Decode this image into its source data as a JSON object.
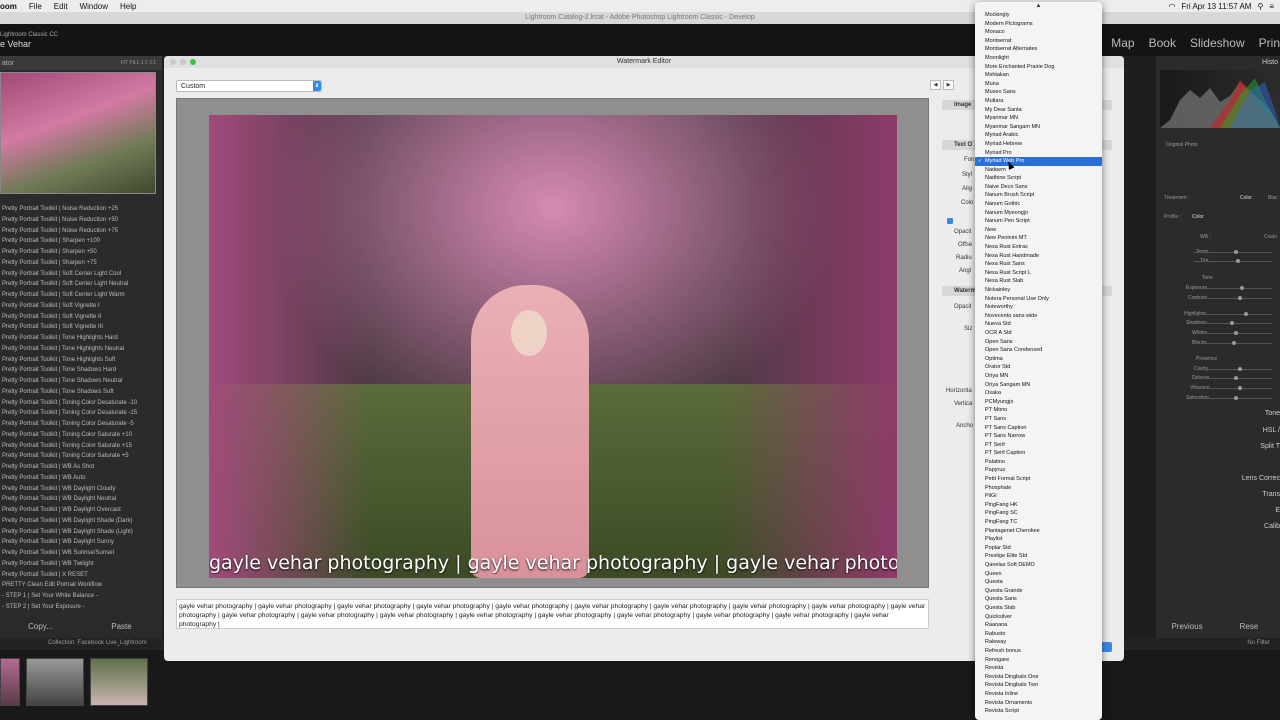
{
  "menubar": {
    "app": "oom",
    "items": [
      "File",
      "Edit",
      "Window",
      "Help"
    ],
    "clock": "Fri Apr 13  11:57 AM"
  },
  "lr_title": "Lightroom Catalog-2.lrcat - Adobe Photoshop Lightroom Classic - Develop",
  "lr_header": {
    "product": "Lightroom Classic CC",
    "user": "e Vehar",
    "modules": [
      "Map",
      "Book",
      "Slideshow",
      "Prin"
    ]
  },
  "left_panel": {
    "title": "ator",
    "zoom": [
      "FIT",
      "FILL",
      "1:1",
      "3:1"
    ],
    "presets": [
      "Pretty Portrait Toolkit | Noise Reduction +25",
      "Pretty Portrait Toolkit | Noise Reduction +50",
      "Pretty Portrait Toolkit | Noise Reduction +75",
      "Pretty Portrait Toolkit | Sharpen +100",
      "Pretty Portrait Toolkit | Sharpen +50",
      "Pretty Portrait Toolkit | Sharpen +75",
      "Pretty Portrait Toolkit | Soft Center Light Cool",
      "Pretty Portrait Toolkit | Soft Center Light Neutral",
      "Pretty Portrait Toolkit | Soft Center Light Warm",
      "Pretty Portrait Toolkit | Soft Vignette I",
      "Pretty Portrait Toolkit | Soft Vignette II",
      "Pretty Portrait Toolkit | Soft Vignette III",
      "Pretty Portrait Toolkit | Tone Highlights Hard",
      "Pretty Portrait Toolkit | Tone Highlights Neutral",
      "Pretty Portrait Toolkit | Tone Highlights Soft",
      "Pretty Portrait Toolkit | Tone Shadows Hard",
      "Pretty Portrait Toolkit | Tone Shadows Neutral",
      "Pretty Portrait Toolkit | Tone Shadows Soft",
      "Pretty Portrait Toolkit | Toning Color Desaturate -10",
      "Pretty Portrait Toolkit | Toning Color Desaturate -15",
      "Pretty Portrait Toolkit | Toning Color Desaturate -5",
      "Pretty Portrait Toolkit | Toning Color Saturate +10",
      "Pretty Portrait Toolkit | Toning Color Saturate +15",
      "Pretty Portrait Toolkit | Toning Color Saturate +5",
      "Pretty Portrait Toolkit | WB As Shot",
      "Pretty Portrait Toolkit | WB Auto",
      "Pretty Portrait Toolkit | WB Daylight Cloudy",
      "Pretty Portrait Toolkit | WB Daylight Neutral",
      "Pretty Portrait Toolkit | WB Daylight Overcast",
      "Pretty Portrait Toolkit | WB Daylight Shade (Dark)",
      "Pretty Portrait Toolkit | WB Daylight Shade (Light)",
      "Pretty Portrait Toolkit | WB Daylight Sunny",
      "Pretty Portrait Toolkit | WB Sunrise/Sunset",
      "Pretty Portrait Toolkit | WB Twilight",
      "Pretty Portrait Toolkit | X RESET",
      "PRETTY Clean Edit Portrait Workflow",
      "- STEP 1 | Set Your White Balance -",
      "- STEP 2 | Set Your Exposure -"
    ],
    "copy": "Copy...",
    "paste": "Paste"
  },
  "right_panel": {
    "histogram": "Histo",
    "original": "Original Photo",
    "treatment": "Treatment :",
    "color": "Color",
    "bw": "Blac",
    "profile": "Profile :",
    "profile_val": "Color",
    "wb": "WB :",
    "wb_val": "Custo",
    "temp": "Temp",
    "tint": "Tint",
    "tone": "Tone",
    "sliders": [
      "Exposure",
      "Contrast",
      "Highlights",
      "Shadows",
      "Whites",
      "Blacks"
    ],
    "presence": "Presence",
    "presence_sliders": [
      "Clarity",
      "Dehaze",
      "Vibrance",
      "Saturation"
    ],
    "sections": [
      "Tone",
      "HSL /",
      "Split T",
      "Lens Correc",
      "Trans",
      "E",
      "Calib"
    ],
    "previous": "Previous",
    "reset": "Rese"
  },
  "filmstrip": {
    "collection": "Collection: Facebook Live_Lightroom",
    "filter": "No Filter"
  },
  "dialog": {
    "title": "Watermark Editor",
    "preset": "Custom",
    "watermark_overlay": "gayle vehar photography | gayle vehar photography | gayle vehar photogra",
    "watermark_text": "gayle vehar photography | gayle vehar photography | gayle vehar photography | gayle vehar photography | gayle vehar photography | gayle vehar photography | gayle vehar photography | gayle vehar photography | gayle vehar photography | gayle vehar photography | gayle vehar photography | gayle vehar photography | gayle vehar photography | gayle vehar photography | gayle vehar photography | gayle vehar photography | gayle vehar photography | gayle vehar photography | gayle vehar photography |",
    "settings": {
      "image": "Image",
      "text_options": "Text O",
      "font": "Fon",
      "style": "Styl",
      "align": "Alig",
      "color": "Colo",
      "opacity": "Opacit",
      "offset": "Offse",
      "radius": "Radiu",
      "angle": "Angl",
      "watermark_effects": "Waterm",
      "opacity2": "Opacit",
      "size": "Siz",
      "horizontal": "Horizonta",
      "vertical": "Vertica",
      "anchor": "Ancho"
    }
  },
  "font_list": {
    "selected": "Myriad Web Pro",
    "items": [
      "Mockingly",
      "Modern Pictograms",
      "Monaco",
      "Montserrat",
      "Montserrat Alternates",
      "Moonlight",
      "More Enchanted Prairie Dog",
      "Mshtakan",
      "Muna",
      "Museo Sans",
      "Mutlara",
      "My Dear Santa",
      "Myanmar MN",
      "Myanmar Sangam MN",
      "Myriad Arabic",
      "Myriad Hebrew",
      "Myriad Pro",
      "Myriad Web Pro",
      "Nadeem",
      "Nadhine Script",
      "Naive Deco Sans",
      "Nanum Brush Script",
      "Nanum Gothic",
      "Nanum Myeongjo",
      "Nanum Pen Script",
      "New",
      "New Peninim MT",
      "Nexa Rust Extras",
      "Nexa Rust Handmade",
      "Nexa Rust Sans",
      "Nexa Rust Script L",
      "Nexa Rust Slab",
      "Nickainley",
      "Notera Personal Use Only",
      "Noteworthy",
      "Novecento sans wide",
      "Nueva Std",
      "OCR A Std",
      "Open Sans",
      "Open Sans Condensed",
      "Optima",
      "Orator Std",
      "Oriya MN",
      "Oriya Sangam MN",
      "Osaka",
      "PCMyungjo",
      "PT Mono",
      "PT Sans",
      "PT Sans Caption",
      "PT Sans Narrow",
      "PT Serif",
      "PT Serif Caption",
      "Palatino",
      "Papyrus",
      "Petit Formal Script",
      "Phosphate",
      "PilGi",
      "PingFang HK",
      "PingFang SC",
      "PingFang TC",
      "Plantagenet Cherokee",
      "Playlist",
      "Poplar Std",
      "Prestige Elite Std",
      "Qanelas Soft DEMO",
      "Queen",
      "Questa",
      "Questa Grande",
      "Questa Sans",
      "Questa Slab",
      "Quicksilver",
      "Raanana",
      "Rabusto",
      "Raleway",
      "Refresh bonus",
      "Renogare",
      "Revista",
      "Revista Dingbats One",
      "Revista Dingbats Two",
      "Revista Inline",
      "Revista Ornaments",
      "Revista Script"
    ]
  }
}
